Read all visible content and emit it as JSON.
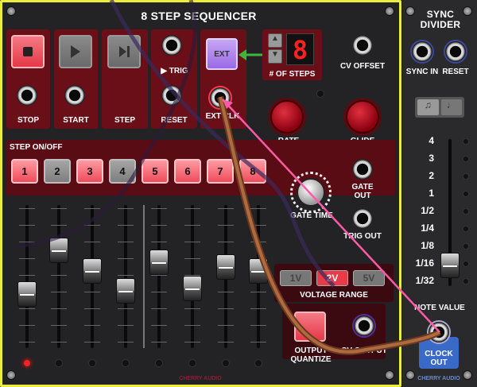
{
  "sequencer": {
    "title": "8 STEP SEQUENCER",
    "buttons": {
      "stop": "STOP",
      "start": "START",
      "step": "STEP",
      "reset": "RESET",
      "trig": "▶ TRIG",
      "ext": "EXT",
      "ext_clk": "EXT CLK"
    },
    "steps_display": {
      "value": "8",
      "label": "# OF STEPS"
    },
    "cv_offset": "CV OFFSET",
    "rate": "RATE",
    "glide": "GLIDE",
    "step_on_off": "STEP ON/OFF",
    "steps": [
      "1",
      "2",
      "3",
      "4",
      "5",
      "6",
      "7",
      "8"
    ],
    "step_states": [
      true,
      false,
      true,
      false,
      true,
      true,
      true,
      true
    ],
    "slider_levels": [
      0.35,
      0.72,
      0.55,
      0.38,
      0.62,
      0.4,
      0.58,
      0.55
    ],
    "gate_time": "GATE TIME",
    "gate_out": "GATE OUT",
    "trig_out": "TRIG OUT",
    "voltage_options": [
      "1V",
      "2V",
      "5V"
    ],
    "voltage_selected": "2V",
    "voltage_range": "VOLTAGE RANGE",
    "output_quantize": "OUTPUT QUANTIZE",
    "cv_output": "CV OUTPUT",
    "brand": "CHERRY AUDIO"
  },
  "divider": {
    "title": "SYNC DIVIDER",
    "sync_in": "SYNC IN",
    "reset": "RESET",
    "scale": [
      "4",
      "3",
      "2",
      "1",
      "1/2",
      "1/4",
      "1/8",
      "1/16",
      "1/32"
    ],
    "note_value": "NOTE VALUE",
    "clock_out": "CLOCK OUT",
    "brand": "CHERRY AUDIO"
  },
  "colors": {
    "frame": "#ecec3a",
    "panel_red": "#6a0e18",
    "step_on": "#ee4c5a",
    "cable_brown": "#8a4a2a",
    "cable_pink": "#ff5aa8",
    "arrow_green": "#3ab83a"
  }
}
